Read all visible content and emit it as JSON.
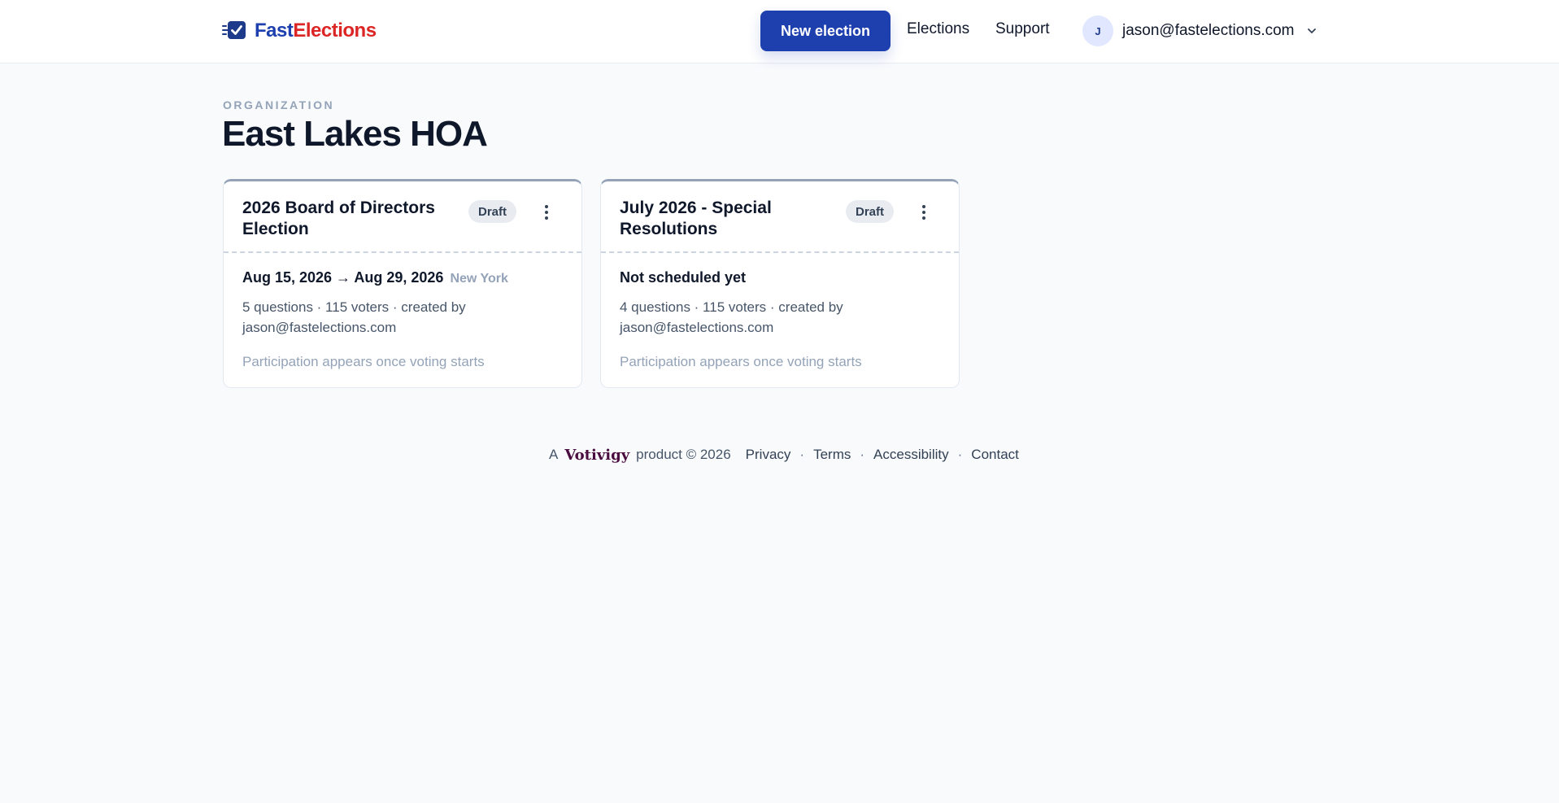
{
  "brand": {
    "name_part1": "Fast",
    "name_part2": "Elections",
    "color_primary": "#1e40af",
    "color_accent": "#dc2626"
  },
  "header": {
    "new_election_label": "New election",
    "nav": [
      "Elections",
      "Support"
    ],
    "user": {
      "avatar_initial": "J",
      "email": "jason@fastelections.com"
    }
  },
  "page": {
    "org_label": "ORGANIZATION",
    "org_name": "East Lakes HOA"
  },
  "elections": [
    {
      "title": "2026 Board of Directors Election",
      "status": "Draft",
      "schedule": "Aug 15, 2026 → Aug 29, 2026",
      "timezone": "New York",
      "meta": "5 questions · 115 voters · created by jason@fastelections.com",
      "participation": "Participation appears once voting starts"
    },
    {
      "title": "July 2026 - Special Resolutions",
      "status": "Draft",
      "schedule": "Not scheduled yet",
      "timezone": "",
      "meta": "4 questions · 115 voters · created by jason@fastelections.com",
      "participation": "Participation appears once voting starts"
    }
  ],
  "footer": {
    "prefix": "A",
    "brand": "Votivigy",
    "suffix": "product © 2026",
    "links": [
      "Privacy",
      "Terms",
      "Accessibility",
      "Contact"
    ]
  },
  "icons": {
    "logo": "checkbox-logo-icon",
    "chevron": "chevron-down-icon",
    "menu": "more-vertical-icon"
  }
}
